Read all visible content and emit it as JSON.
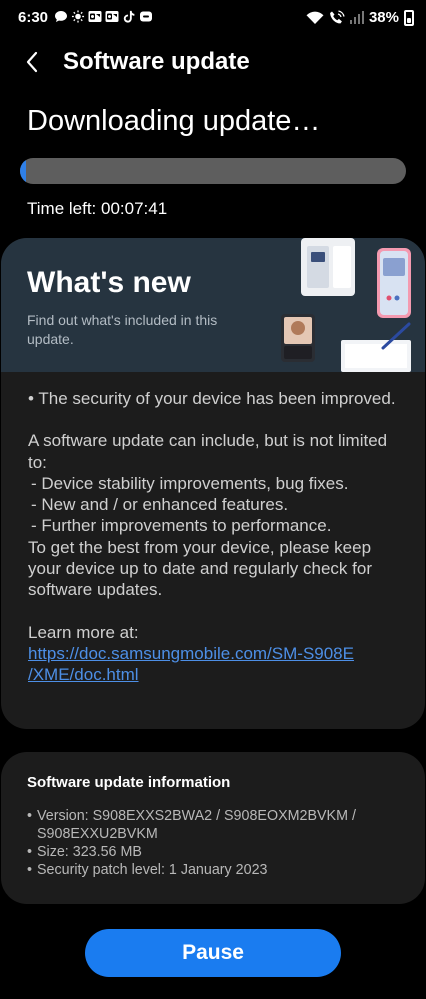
{
  "status_bar": {
    "time": "6:30",
    "battery": "38%",
    "battery_level": 0.38,
    "left_icons": [
      "chat-bubble-icon",
      "brightness-icon",
      "outlook-icon",
      "outlook-icon",
      "tiktok-icon",
      "app-badge-icon"
    ],
    "right_icons": [
      "wifi-icon",
      "wifi-calling-icon",
      "signal-icon",
      "battery-icon"
    ]
  },
  "header": {
    "title": "Software update",
    "back_icon": "chevron-left-icon"
  },
  "download": {
    "title": "Downloading update…",
    "progress": 0.015,
    "time_left": "Time left: 00:07:41"
  },
  "whats_new": {
    "title": "What's new",
    "subtitle": "Find out what's included in this update.",
    "notes": {
      "line1": "• The security of your device has been improved.",
      "intro": "A software update can include, but is not limited to:",
      "items": [
        " - Device stability improvements, bug fixes.",
        " - New and / or enhanced features.",
        " - Further improvements to performance."
      ],
      "closing": "To get the best from your device, please keep your device up to date and regularly check for software updates.",
      "learn_more": "Learn more at:",
      "link": "https://doc.samsungmobile.com/SM-S908E/XME/doc.html"
    }
  },
  "info": {
    "title": "Software update information",
    "version": "Version: S908EXXS2BWA2 / S908EOXM2BVKM / S908EXXU2BVKM",
    "size": "Size: 323.56 MB",
    "security_patch": "Security patch level: 1 January 2023"
  },
  "pause_label": "Pause",
  "colors": {
    "accent": "#1a7cf0",
    "progress": "#2f80e8",
    "link": "#4d8fe6",
    "card": "#1c1c1c",
    "banner": "#263440"
  }
}
